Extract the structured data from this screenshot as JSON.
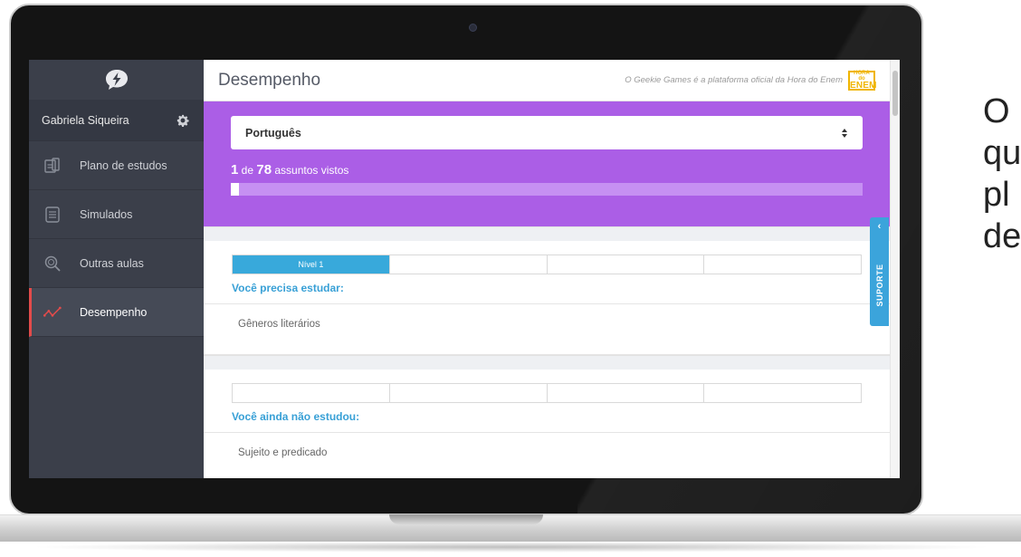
{
  "sidebar": {
    "user_name": "Gabriela Siqueira",
    "items": [
      {
        "label": "Plano de estudos",
        "icon": "study-plan-icon"
      },
      {
        "label": "Simulados",
        "icon": "exam-list-icon"
      },
      {
        "label": "Outras aulas",
        "icon": "search-icon"
      },
      {
        "label": "Desempenho",
        "icon": "performance-chart-icon",
        "active": true
      }
    ]
  },
  "header": {
    "title": "Desempenho",
    "tagline": "O Geekie Games é a plataforma oficial da Hora do Enem",
    "badge_top": "HORA do",
    "badge_main": "ENEM"
  },
  "subject_select": {
    "value": "Português"
  },
  "progress": {
    "seen": "1",
    "of": " de ",
    "total": "78",
    "suffix": " assuntos vistos",
    "fraction": 0.0128
  },
  "sections": [
    {
      "levels": [
        "Nível 1",
        "",
        "",
        ""
      ],
      "filled_levels": 1,
      "heading": "Você precisa estudar:",
      "topic": "Gêneros literários"
    },
    {
      "levels": [
        "",
        "",
        "",
        ""
      ],
      "filled_levels": 0,
      "heading": "Você ainda não estudou:",
      "topic": "Sujeito e predicado"
    }
  ],
  "support_tab": {
    "label": "SUPORTE",
    "chevron": "‹"
  },
  "side_caption": [
    "O",
    "qu",
    "pl",
    "de"
  ],
  "colors": {
    "sidebar_bg": "#3b3f4a",
    "accent_purple": "#ab5ee6",
    "accent_blue": "#38a9db",
    "active_marker": "#e24b4b",
    "badge_yellow": "#f0b500"
  }
}
